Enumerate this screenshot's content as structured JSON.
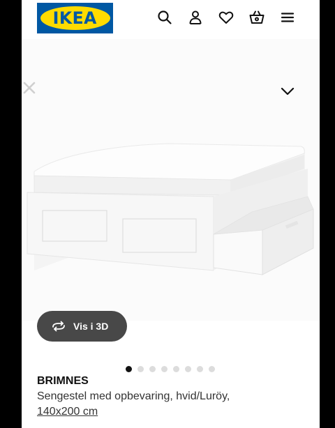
{
  "header": {
    "logo_text": "IKEA",
    "icons": [
      "search-icon",
      "account-icon",
      "heart-icon",
      "basket-icon",
      "menu-icon"
    ]
  },
  "gallery": {
    "view_3d_label": "Vis i 3D",
    "image_count": 8,
    "active_index": 0
  },
  "product": {
    "name": "BRIMNES",
    "description": "Sengestel med opbevaring, hvid/Luröy,",
    "size": "140x200 cm"
  },
  "colors": {
    "ikea_blue": "#0058a3",
    "ikea_yellow": "#ffdb00",
    "button_bg": "#484848"
  }
}
